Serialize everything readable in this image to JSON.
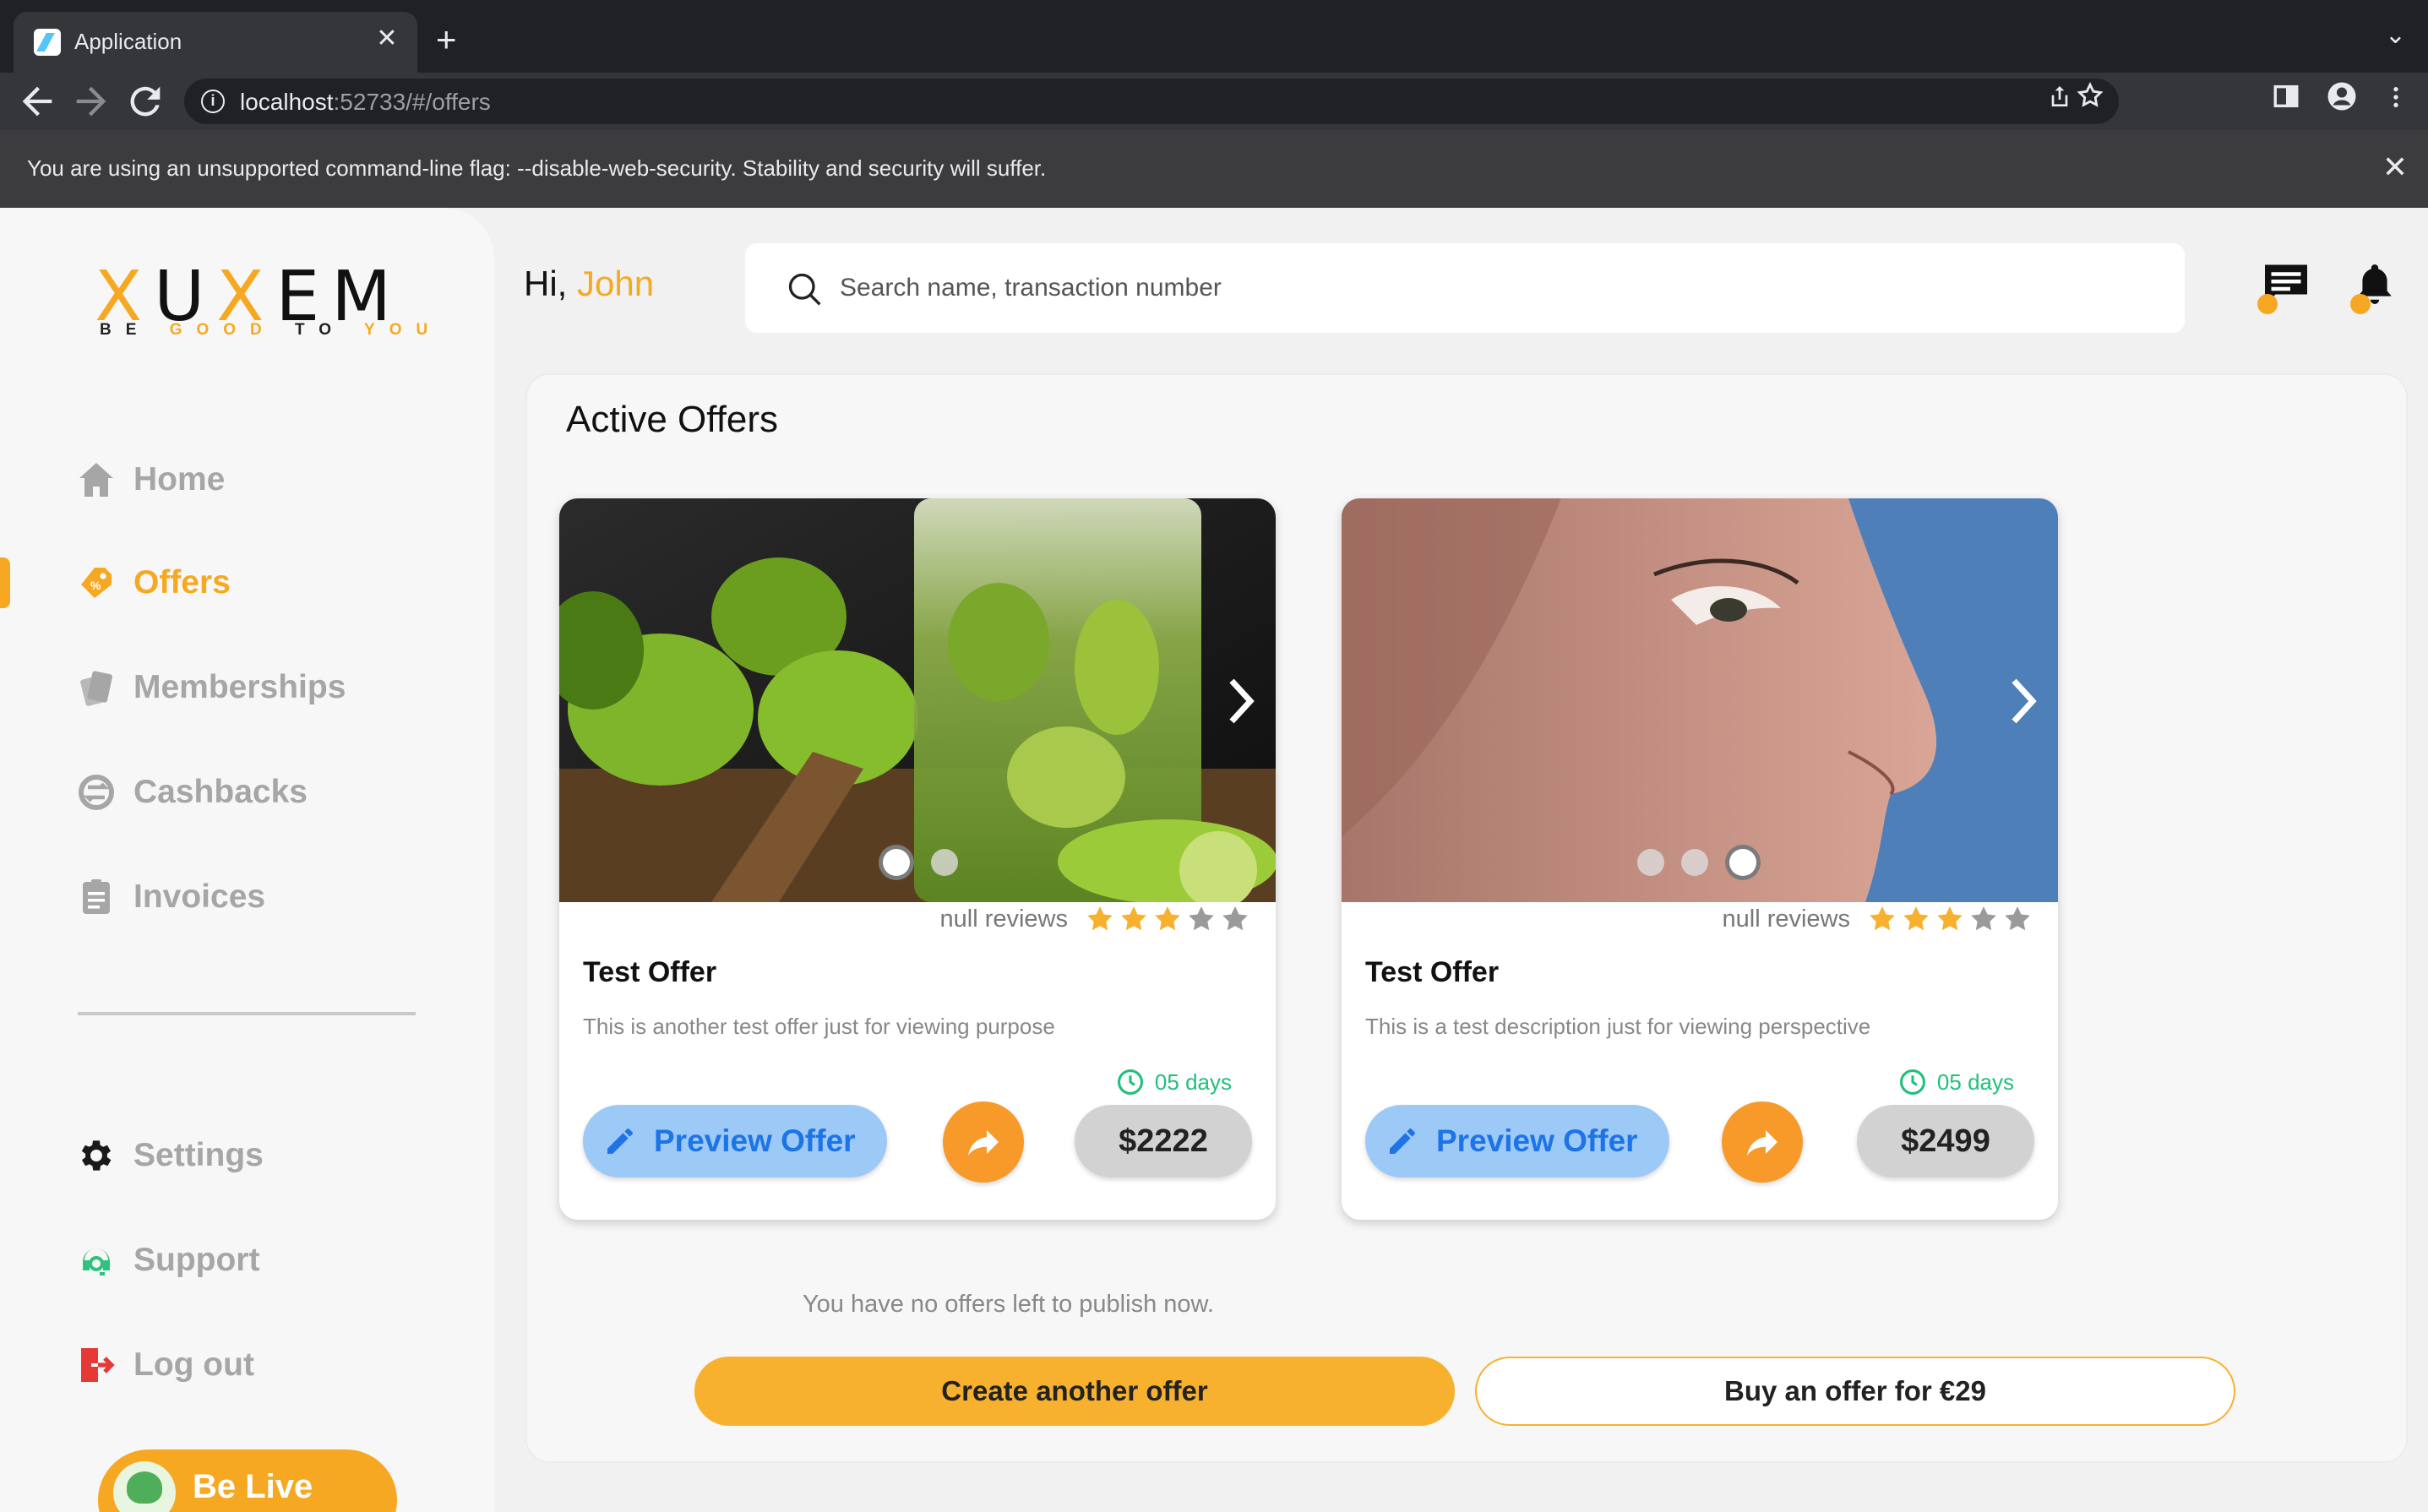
{
  "browser": {
    "tab_title": "Application",
    "tab_close": "✕",
    "new_tab": "+",
    "tab_dropdown": "⌄",
    "url_host": "localhost",
    "url_path": ":52733/#/offers",
    "infobar_text": "You are using an unsupported command-line flag: --disable-web-security. Stability and security will suffer.",
    "infobar_close": "✕",
    "icons": [
      "back-icon",
      "forward-icon",
      "reload-icon",
      "info-icon",
      "share-icon",
      "bookmark-star-icon",
      "side-panel-icon",
      "profile-icon",
      "menu-icon"
    ]
  },
  "brand": {
    "logo_word_parts": [
      "X",
      "U",
      "X",
      "EM"
    ],
    "tagline_parts": [
      "BE ",
      "GOOD",
      " TO ",
      "YOU"
    ],
    "accent": "#f7a823"
  },
  "sidebar": {
    "items": [
      {
        "label": "Home",
        "icon": "home-icon"
      },
      {
        "label": "Offers",
        "icon": "offers-tag-icon"
      },
      {
        "label": "Memberships",
        "icon": "memberships-cards-icon"
      },
      {
        "label": "Cashbacks",
        "icon": "cashbacks-icon"
      },
      {
        "label": "Invoices",
        "icon": "invoice-icon"
      },
      {
        "label": "Settings",
        "icon": "gear-icon"
      },
      {
        "label": "Support",
        "icon": "support-headset-icon"
      },
      {
        "label": "Log out",
        "icon": "logout-icon"
      }
    ],
    "active": "Offers",
    "belive_label": "Be Live"
  },
  "header": {
    "greeting_prefix": "Hi, ",
    "user_name": "John",
    "search_placeholder": "Search name, transaction number"
  },
  "main": {
    "title": "Active Offers",
    "offers": [
      {
        "title": "Test Offer",
        "description": "This is another test offer just for viewing purpose",
        "reviews": "null reviews",
        "rating": 3,
        "rating_max": 5,
        "validity": "05 days",
        "price": "$2222",
        "preview_label": "Preview Offer",
        "image_slides": 2,
        "active_slide": 1,
        "image_subject": "lime drink in glass"
      },
      {
        "title": "Test Offer",
        "description": "This is a test description just for viewing perspective",
        "reviews": "null reviews",
        "rating": 3,
        "rating_max": 5,
        "validity": "05 days",
        "price": "$2499",
        "preview_label": "Preview Offer",
        "image_slides": 3,
        "active_slide": 3,
        "image_subject": "woman profile nose"
      }
    ],
    "empty_message": "You have no offers left to publish now.",
    "create_button": "Create another offer",
    "buy_button": "Buy an offer for €29"
  }
}
